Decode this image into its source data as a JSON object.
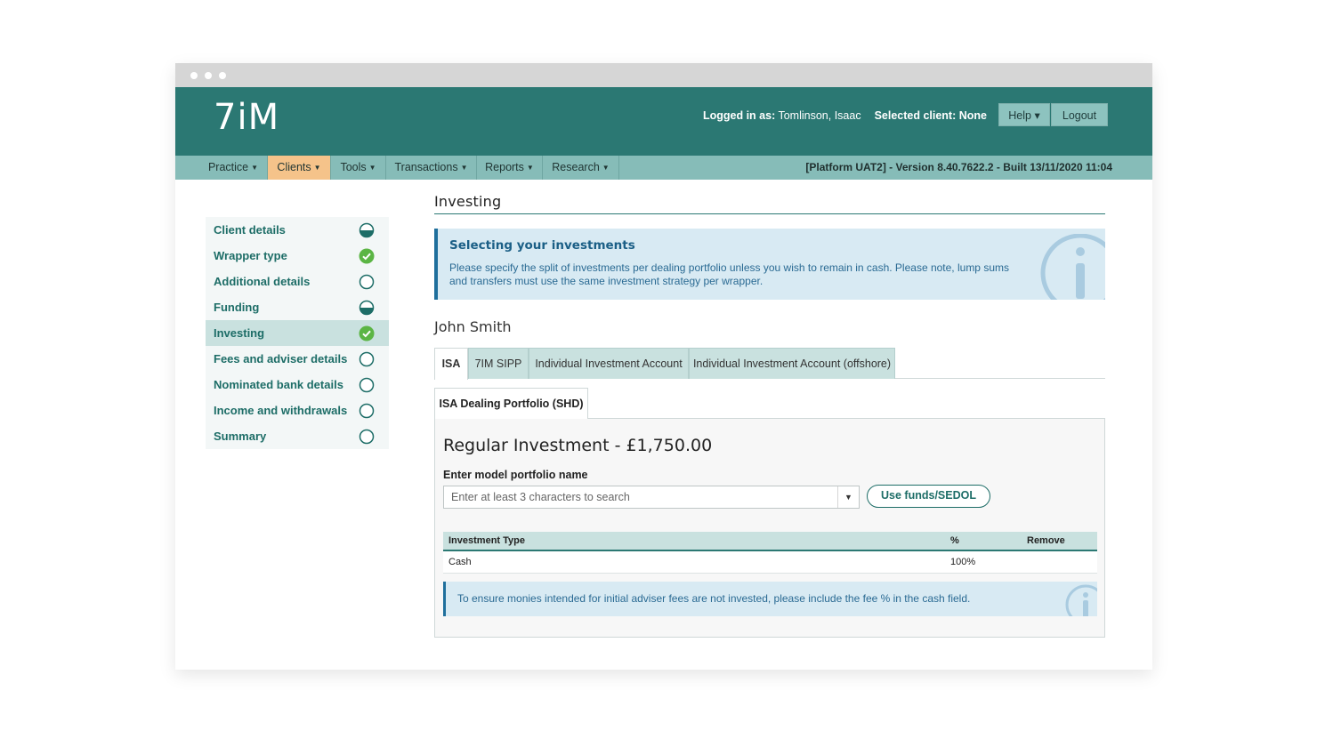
{
  "app": {
    "logo": "7iM",
    "login": {
      "logged_label": "Logged in as:",
      "logged_user": "Tomlinson, Isaac",
      "client_label": "Selected client:",
      "client_value": "None"
    },
    "help_label": "Help ▾",
    "logout_label": "Logout"
  },
  "nav": {
    "items": [
      {
        "label": "Practice"
      },
      {
        "label": "Clients"
      },
      {
        "label": "Tools"
      },
      {
        "label": "Transactions"
      },
      {
        "label": "Reports"
      },
      {
        "label": "Research"
      }
    ],
    "build": "[Platform UAT2] - Version 8.40.7622.2 - Built 13/11/2020 11:04"
  },
  "sidebar": {
    "items": [
      {
        "label": "Client details",
        "status": "half"
      },
      {
        "label": "Wrapper type",
        "status": "complete"
      },
      {
        "label": "Additional details",
        "status": "empty"
      },
      {
        "label": "Funding",
        "status": "half"
      },
      {
        "label": "Investing",
        "status": "complete"
      },
      {
        "label": "Fees and adviser details",
        "status": "empty"
      },
      {
        "label": "Nominated bank details",
        "status": "empty"
      },
      {
        "label": "Income and withdrawals",
        "status": "empty"
      },
      {
        "label": "Summary",
        "status": "empty"
      }
    ]
  },
  "main": {
    "title": "Investing",
    "info": {
      "title": "Selecting your investments",
      "text": "Please specify the split of investments per dealing portfolio unless you wish to remain in cash. Please note, lump sums and transfers must use the same investment strategy per wrapper."
    },
    "client_name": "John Smith",
    "tabs": [
      {
        "label": "ISA"
      },
      {
        "label": "7IM SIPP"
      },
      {
        "label": "Individual Investment Account"
      },
      {
        "label": "Individual Investment Account (offshore)"
      }
    ],
    "subtab": "ISA Dealing Portfolio (SHD)",
    "regular_title": "Regular Investment - £1,750.00",
    "model_label": "Enter model portfolio name",
    "model_placeholder": "Enter at least 3 characters to search",
    "funds_button": "Use funds/SEDOL",
    "table": {
      "headers": [
        "Investment Type",
        "%",
        "Remove"
      ],
      "rows": [
        [
          "Cash",
          "100%",
          ""
        ]
      ]
    },
    "note": "To ensure monies intended for initial adviser fees are not invested, please include the fee % in the cash field."
  },
  "colors": {
    "brand": "#2b7873",
    "nav": "#86bcb8",
    "active_nav": "#f5c38a",
    "complete": "#5bb544"
  }
}
